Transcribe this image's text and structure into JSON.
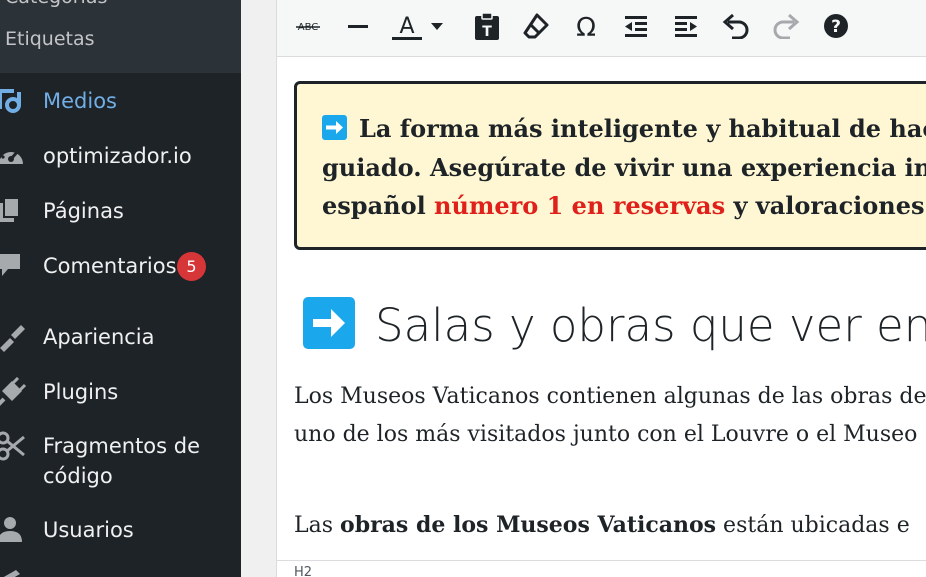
{
  "sidebar": {
    "submenu": {
      "cut_item": "Categorías",
      "tags": "Etiquetas"
    },
    "items": [
      {
        "label": "Medios",
        "icon": "media-icon",
        "active": true
      },
      {
        "label": "optimizador.io",
        "icon": "dashboard-gauge-icon"
      },
      {
        "label": "Páginas",
        "icon": "pages-icon"
      },
      {
        "label": "Comentarios",
        "icon": "comments-icon",
        "badge": "5"
      },
      {
        "label": "Apariencia",
        "icon": "appearance-brush-icon"
      },
      {
        "label": "Plugins",
        "icon": "plugins-icon"
      },
      {
        "label": "Fragmentos de",
        "label2": "código",
        "icon": "scissors-icon"
      },
      {
        "label": "Usuarios",
        "icon": "users-icon"
      }
    ],
    "colors": {
      "background": "#1d2327",
      "active": "#72aee6",
      "badge": "#d63638"
    }
  },
  "toolbar": {
    "buttons": [
      "strikethrough-icon",
      "horizontal-line-icon",
      "text-color-icon",
      "text-color-dropdown-icon",
      "paste-as-text-icon",
      "clear-formatting-icon",
      "special-character-icon",
      "outdent-icon",
      "indent-icon",
      "undo-icon",
      "redo-icon",
      "help-icon"
    ],
    "text_color_glyph": "A",
    "omega_glyph": "Ω",
    "help_glyph": "?"
  },
  "content": {
    "callout": {
      "line1": "La forma más inteligente y habitual de hacer",
      "line2": "guiado. Asegúrate de vivir una experiencia inol",
      "line3_before": "español ",
      "line3_red": "número 1 en reservas",
      "line3_after": " y valoraciones p",
      "background": "#fff7d3"
    },
    "heading": "Salas y obras que ver en los",
    "paragraph1": {
      "line1": "Los Museos Vaticanos contienen algunas de las obras de",
      "line2": "uno de los más visitados junto con el Louvre o el Museo"
    },
    "paragraph2": {
      "prefix": "Las ",
      "bold": "obras de los Museos Vaticanos",
      "suffix": " están ubicadas e"
    },
    "accent_color": "#1aa7ec"
  },
  "status_bar": {
    "path": "H2"
  }
}
